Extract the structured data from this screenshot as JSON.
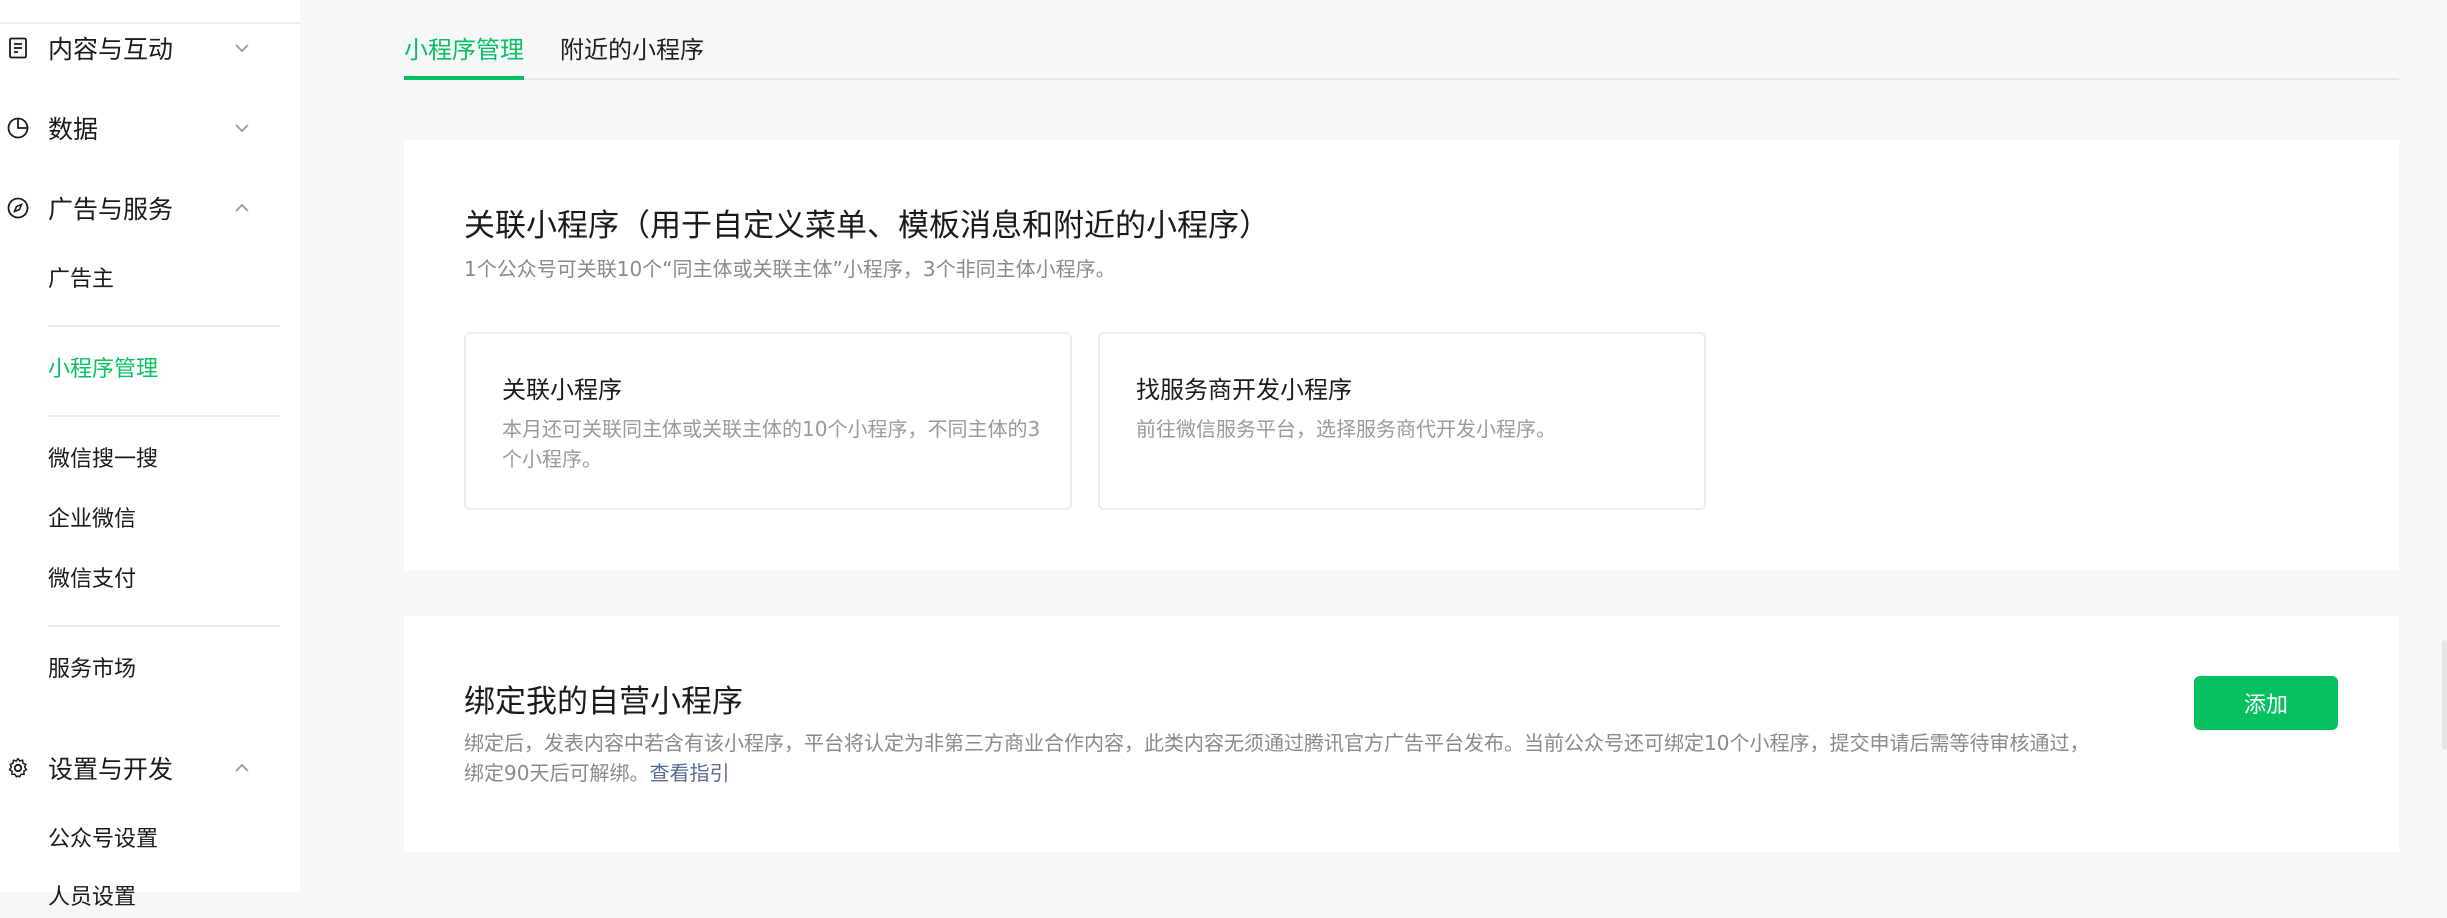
{
  "sidebar": {
    "groups": [
      {
        "label": "内容与互动",
        "icon": "document-icon",
        "expanded": false
      },
      {
        "label": "数据",
        "icon": "pie-chart-icon",
        "expanded": false
      },
      {
        "label": "广告与服务",
        "icon": "compass-icon",
        "expanded": true
      },
      {
        "label": "设置与开发",
        "icon": "gear-icon",
        "expanded": true
      }
    ],
    "ads_items": [
      "广告主",
      "小程序管理",
      "微信搜一搜",
      "企业微信",
      "微信支付",
      "服务市场"
    ],
    "settings_items": [
      "公众号设置",
      "人员设置"
    ],
    "active_item": "小程序管理"
  },
  "tabs": [
    {
      "label": "小程序管理",
      "active": true
    },
    {
      "label": "附近的小程序",
      "active": false
    }
  ],
  "link_section": {
    "title": "关联小程序（用于自定义菜单、模板消息和附近的小程序）",
    "desc": "1个公众号可关联10个“同主体或关联主体”小程序，3个非同主体小程序。",
    "options": [
      {
        "title": "关联小程序",
        "desc": "本月还可关联同主体或关联主体的10个小程序，不同主体的3个小程序。"
      },
      {
        "title": "找服务商开发小程序",
        "desc": "前往微信服务平台，选择服务商代开发小程序。"
      }
    ]
  },
  "bind_section": {
    "title": "绑定我的自营小程序",
    "desc": "绑定后，发表内容中若含有该小程序，平台将认定为非第三方商业合作内容，此类内容无须通过腾讯官方广告平台发布。当前公众号还可绑定10个小程序，提交申请后需等待审核通过，绑定90天后可解绑。",
    "link": "查看指引",
    "button": "添加"
  },
  "colors": {
    "accent": "#07c160",
    "link": "#576b95",
    "muted": "#8a8a8a"
  }
}
